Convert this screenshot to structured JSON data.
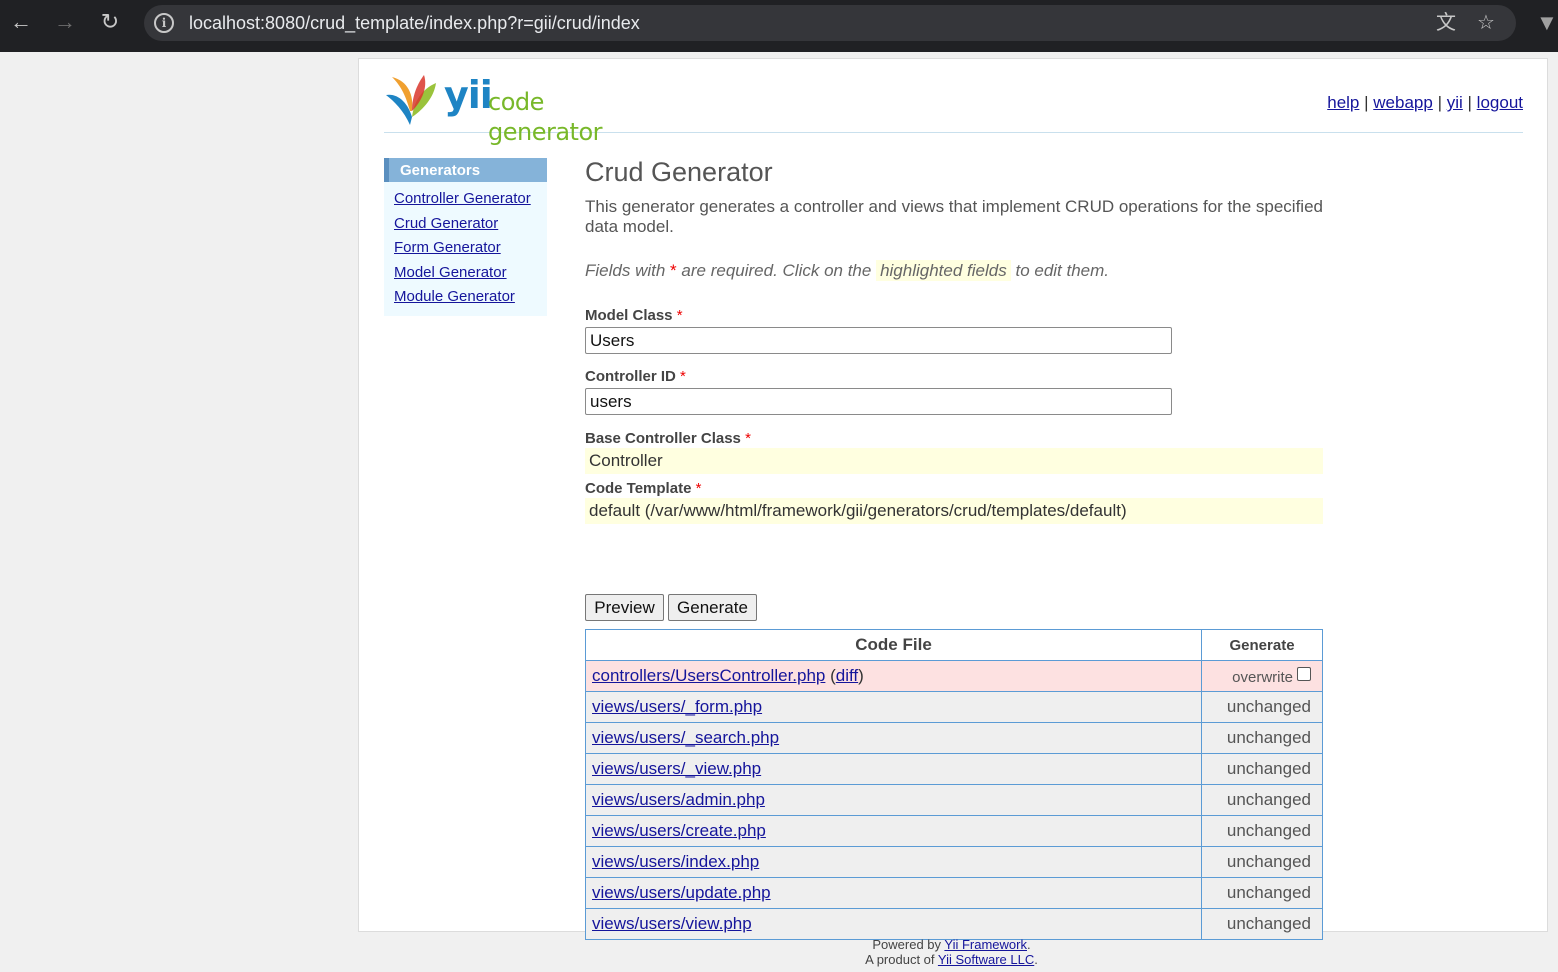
{
  "browser": {
    "url": "localhost:8080/crud_template/index.php?r=gii/crud/index"
  },
  "header": {
    "logo_yii": "yii",
    "logo_text": "code generator",
    "links": [
      "help",
      "webapp",
      "yii",
      "logout"
    ],
    "separator": "|"
  },
  "sidebar": {
    "title": "Generators",
    "items": [
      "Controller Generator",
      "Crud Generator",
      "Form Generator",
      "Model Generator",
      "Module Generator"
    ]
  },
  "main": {
    "title": "Crud Generator",
    "description": "This generator generates a controller and views that implement CRUD operations for the specified data model.",
    "hint_pre": "Fields with",
    "hint_req": "*",
    "hint_mid": "are required. Click on the",
    "hint_highlight": "highlighted fields",
    "hint_post": "to edit them.",
    "fields": {
      "model_class": {
        "label": "Model Class",
        "value": "Users"
      },
      "controller_id": {
        "label": "Controller ID",
        "value": "users"
      },
      "base_controller": {
        "label": "Base Controller Class",
        "value": "Controller"
      },
      "code_template": {
        "label": "Code Template",
        "value": "default (/var/www/html/framework/gii/generators/crud/templates/default)"
      }
    },
    "required_mark": "*",
    "buttons": {
      "preview": "Preview",
      "generate": "Generate"
    }
  },
  "table": {
    "headers": {
      "file": "Code File",
      "generate": "Generate"
    },
    "rows": [
      {
        "file": "controllers/UsersController.php",
        "diff": "diff",
        "status": "overwrite",
        "checkbox": true
      },
      {
        "file": "views/users/_form.php",
        "status": "unchanged"
      },
      {
        "file": "views/users/_search.php",
        "status": "unchanged"
      },
      {
        "file": "views/users/_view.php",
        "status": "unchanged"
      },
      {
        "file": "views/users/admin.php",
        "status": "unchanged"
      },
      {
        "file": "views/users/create.php",
        "status": "unchanged"
      },
      {
        "file": "views/users/index.php",
        "status": "unchanged"
      },
      {
        "file": "views/users/update.php",
        "status": "unchanged"
      },
      {
        "file": "views/users/view.php",
        "status": "unchanged"
      }
    ]
  },
  "footer": {
    "powered_pre": "Powered by",
    "powered_link": "Yii Framework",
    "product_pre": "A product of",
    "product_link": "Yii Software LLC"
  }
}
